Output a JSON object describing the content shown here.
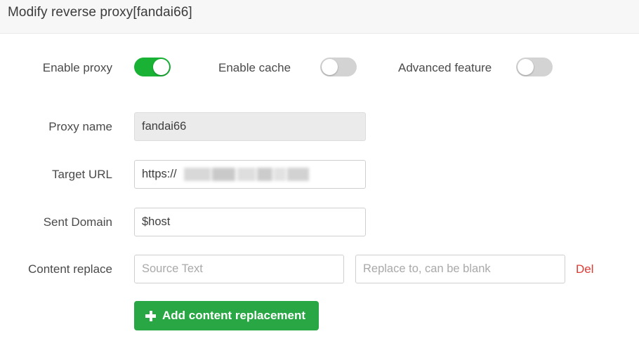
{
  "header": {
    "title": "Modify reverse proxy[fandai66]"
  },
  "switches": {
    "enable_proxy": {
      "label": "Enable proxy",
      "state": "on",
      "on_color": "#19b235"
    },
    "enable_cache": {
      "label": "Enable cache",
      "state": "off",
      "off_color": "#d3d3d3"
    },
    "advanced_feature": {
      "label": "Advanced feature",
      "state": "off",
      "off_color": "#d3d3d3"
    }
  },
  "fields": {
    "proxy_name": {
      "label": "Proxy name",
      "value": "fandai66",
      "placeholder": "",
      "disabled": true
    },
    "target_url": {
      "label": "Target URL",
      "value": "https://",
      "placeholder": "",
      "redacted": true
    },
    "sent_domain": {
      "label": "Sent Domain",
      "value": "$host",
      "placeholder": ""
    },
    "content_replace": {
      "label": "Content replace",
      "source_value": "",
      "source_placeholder": "Source Text",
      "target_value": "",
      "target_placeholder": "Replace to, can be blank",
      "delete_label": "Del",
      "delete_color": "#e03a35"
    }
  },
  "actions": {
    "add_replacement": {
      "label": "Add content replacement",
      "icon": "plus-icon",
      "color": "#29a745"
    }
  }
}
